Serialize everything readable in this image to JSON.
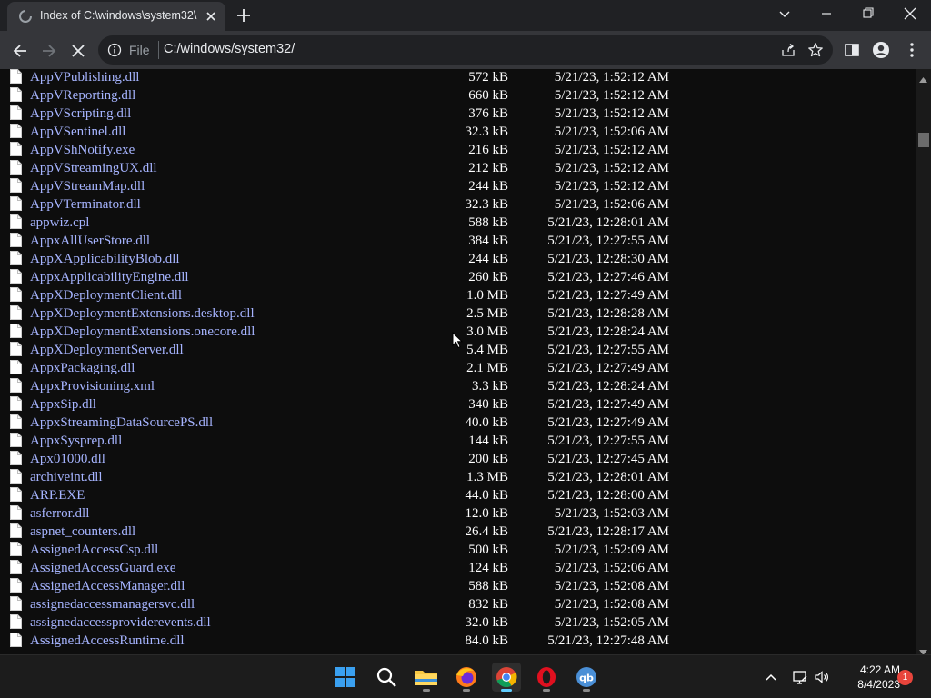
{
  "browser": {
    "tab_title": "Index of C:\\windows\\system32\\",
    "address_scheme": "File",
    "address_url": "C:/windows/system32/"
  },
  "files": [
    {
      "name": "AppVPublishing.dll",
      "size": "572 kB",
      "date": "5/21/23, 1:52:12 AM"
    },
    {
      "name": "AppVReporting.dll",
      "size": "660 kB",
      "date": "5/21/23, 1:52:12 AM"
    },
    {
      "name": "AppVScripting.dll",
      "size": "376 kB",
      "date": "5/21/23, 1:52:12 AM"
    },
    {
      "name": "AppVSentinel.dll",
      "size": "32.3 kB",
      "date": "5/21/23, 1:52:06 AM"
    },
    {
      "name": "AppVShNotify.exe",
      "size": "216 kB",
      "date": "5/21/23, 1:52:12 AM"
    },
    {
      "name": "AppVStreamingUX.dll",
      "size": "212 kB",
      "date": "5/21/23, 1:52:12 AM"
    },
    {
      "name": "AppVStreamMap.dll",
      "size": "244 kB",
      "date": "5/21/23, 1:52:12 AM"
    },
    {
      "name": "AppVTerminator.dll",
      "size": "32.3 kB",
      "date": "5/21/23, 1:52:06 AM"
    },
    {
      "name": "appwiz.cpl",
      "size": "588 kB",
      "date": "5/21/23, 12:28:01 AM"
    },
    {
      "name": "AppxAllUserStore.dll",
      "size": "384 kB",
      "date": "5/21/23, 12:27:55 AM"
    },
    {
      "name": "AppXApplicabilityBlob.dll",
      "size": "244 kB",
      "date": "5/21/23, 12:28:30 AM"
    },
    {
      "name": "AppxApplicabilityEngine.dll",
      "size": "260 kB",
      "date": "5/21/23, 12:27:46 AM"
    },
    {
      "name": "AppXDeploymentClient.dll",
      "size": "1.0 MB",
      "date": "5/21/23, 12:27:49 AM"
    },
    {
      "name": "AppXDeploymentExtensions.desktop.dll",
      "size": "2.5 MB",
      "date": "5/21/23, 12:28:28 AM"
    },
    {
      "name": "AppXDeploymentExtensions.onecore.dll",
      "size": "3.0 MB",
      "date": "5/21/23, 12:28:24 AM"
    },
    {
      "name": "AppXDeploymentServer.dll",
      "size": "5.4 MB",
      "date": "5/21/23, 12:27:55 AM"
    },
    {
      "name": "AppxPackaging.dll",
      "size": "2.1 MB",
      "date": "5/21/23, 12:27:49 AM"
    },
    {
      "name": "AppxProvisioning.xml",
      "size": "3.3 kB",
      "date": "5/21/23, 12:28:24 AM"
    },
    {
      "name": "AppxSip.dll",
      "size": "340 kB",
      "date": "5/21/23, 12:27:49 AM"
    },
    {
      "name": "AppxStreamingDataSourcePS.dll",
      "size": "40.0 kB",
      "date": "5/21/23, 12:27:49 AM"
    },
    {
      "name": "AppxSysprep.dll",
      "size": "144 kB",
      "date": "5/21/23, 12:27:55 AM"
    },
    {
      "name": "Apx01000.dll",
      "size": "200 kB",
      "date": "5/21/23, 12:27:45 AM"
    },
    {
      "name": "archiveint.dll",
      "size": "1.3 MB",
      "date": "5/21/23, 12:28:01 AM"
    },
    {
      "name": "ARP.EXE",
      "size": "44.0 kB",
      "date": "5/21/23, 12:28:00 AM"
    },
    {
      "name": "asferror.dll",
      "size": "12.0 kB",
      "date": "5/21/23, 1:52:03 AM"
    },
    {
      "name": "aspnet_counters.dll",
      "size": "26.4 kB",
      "date": "5/21/23, 12:28:17 AM"
    },
    {
      "name": "AssignedAccessCsp.dll",
      "size": "500 kB",
      "date": "5/21/23, 1:52:09 AM"
    },
    {
      "name": "AssignedAccessGuard.exe",
      "size": "124 kB",
      "date": "5/21/23, 1:52:06 AM"
    },
    {
      "name": "AssignedAccessManager.dll",
      "size": "588 kB",
      "date": "5/21/23, 1:52:08 AM"
    },
    {
      "name": "assignedaccessmanagersvc.dll",
      "size": "832 kB",
      "date": "5/21/23, 1:52:08 AM"
    },
    {
      "name": "assignedaccessproviderevents.dll",
      "size": "32.0 kB",
      "date": "5/21/23, 1:52:05 AM"
    },
    {
      "name": "AssignedAccessRuntime.dll",
      "size": "84.0 kB",
      "date": "5/21/23, 12:27:48 AM"
    }
  ],
  "taskbar": {
    "apps": [
      {
        "name": "start",
        "icon": "windows-logo-icon",
        "active": false
      },
      {
        "name": "search",
        "icon": "search-icon",
        "active": false
      },
      {
        "name": "file-explorer",
        "icon": "folder-icon",
        "active": false
      },
      {
        "name": "firefox",
        "icon": "firefox-icon",
        "active": false
      },
      {
        "name": "chrome",
        "icon": "chrome-icon",
        "active": true
      },
      {
        "name": "opera",
        "icon": "opera-icon",
        "active": false
      },
      {
        "name": "qbittorrent",
        "icon": "qbittorrent-icon",
        "active": false
      }
    ],
    "time": "4:22 AM",
    "date": "8/4/2023",
    "notification_count": "1"
  },
  "colors": {
    "link": "#a6b4ff",
    "page_bg": "#0d0d0d",
    "accent": "#60cdff"
  }
}
